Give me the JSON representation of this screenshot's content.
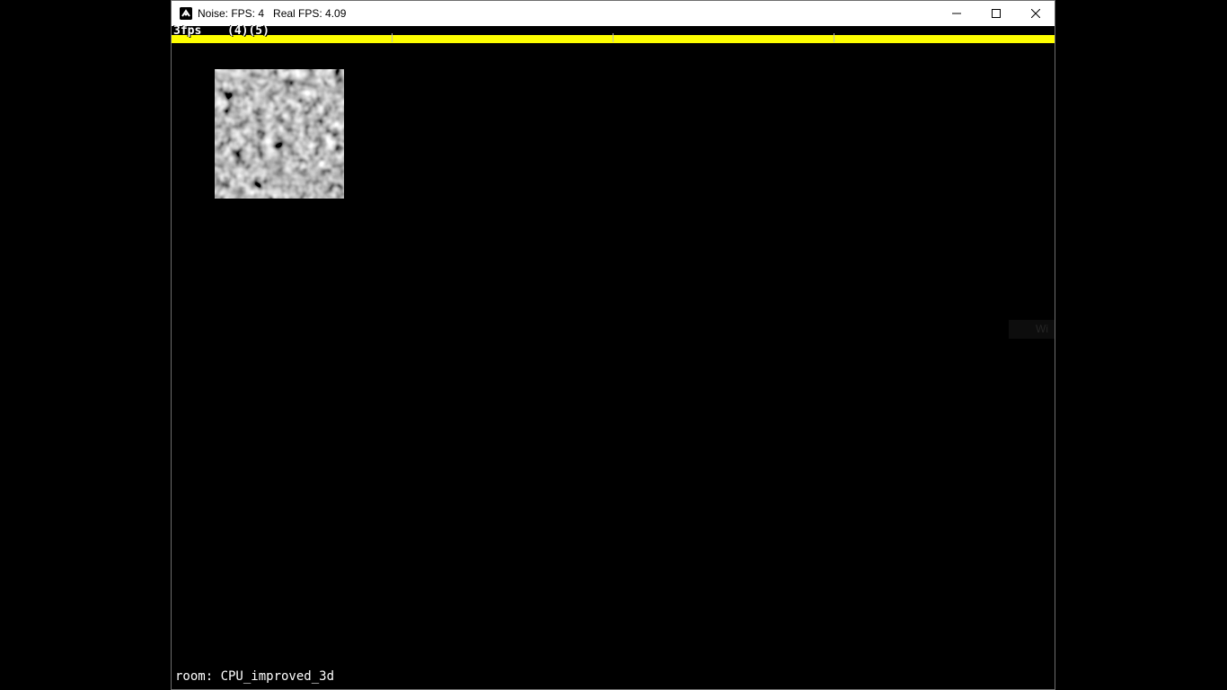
{
  "window": {
    "title": "Noise: FPS: 4   Real FPS: 4.09",
    "controls": {
      "minimize_icon": "minimize-icon",
      "maximize_icon": "maximize-icon",
      "close_icon": "close-icon"
    }
  },
  "debug_overlay": {
    "fps_label": "3fps",
    "counts_label": "(4)(5)",
    "bar_color": "#ffff00"
  },
  "texture": {
    "description_icon": "noise-texture",
    "colors": [
      "#000000",
      "#ffffff"
    ]
  },
  "watermark": {
    "text": "Wi"
  },
  "status": {
    "room_label": "room: CPU_improved_3d"
  }
}
